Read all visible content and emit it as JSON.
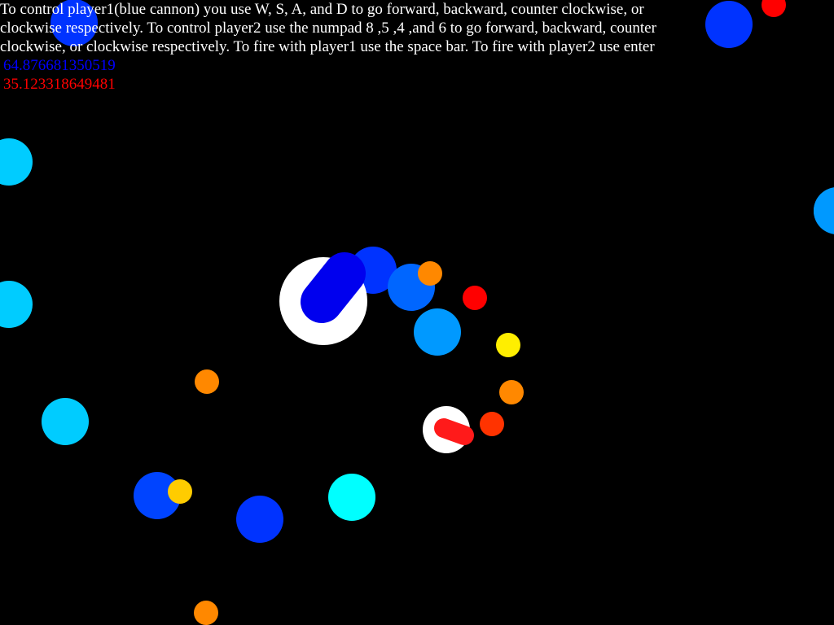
{
  "instructions": "To control player1(blue cannon) you use W, S, A, and D to go forward, backward, counter clockwise, or clockwise respectively. To control player2 use the numpad 8 ,5 ,4 ,and 6 to go forward, backward, counter clockwise, or clockwise respectively.  To fire with player1 use the space bar.  To fire with player2 use enter",
  "scores": {
    "player1": "64.876681350519",
    "player2": "35.123318649481"
  },
  "colors": {
    "background": "#000000",
    "player1": "#0000ff",
    "player2": "#ff0000",
    "base": "#ffffff"
  },
  "players": [
    {
      "name": "player1",
      "color": "#0000ee",
      "barrel_color": "#0000ee",
      "base_color": "#ffffff"
    },
    {
      "name": "player2",
      "color": "#ff0000",
      "barrel_color": "#ff1a1a",
      "base_color": "#ffffff"
    }
  ],
  "projectiles": [
    {
      "color": "#0033ff"
    },
    {
      "color": "#ff0000"
    },
    {
      "color": "#00ccff"
    },
    {
      "color": "#0099ff"
    },
    {
      "color": "#00ccff"
    },
    {
      "color": "#0033ff"
    },
    {
      "color": "#0066ff"
    },
    {
      "color": "#ff8800"
    },
    {
      "color": "#ff0000"
    },
    {
      "color": "#0099ff"
    },
    {
      "color": "#ffee00"
    },
    {
      "color": "#ff8800"
    },
    {
      "color": "#ff3300"
    },
    {
      "color": "#ff8800"
    },
    {
      "color": "#00ccff"
    },
    {
      "color": "#0044ff"
    },
    {
      "color": "#ffcc00"
    },
    {
      "color": "#0033ff"
    },
    {
      "color": "#00ffff"
    },
    {
      "color": "#ff8800"
    },
    {
      "color": "#0033ff"
    },
    {
      "color": "#0099ff"
    }
  ]
}
